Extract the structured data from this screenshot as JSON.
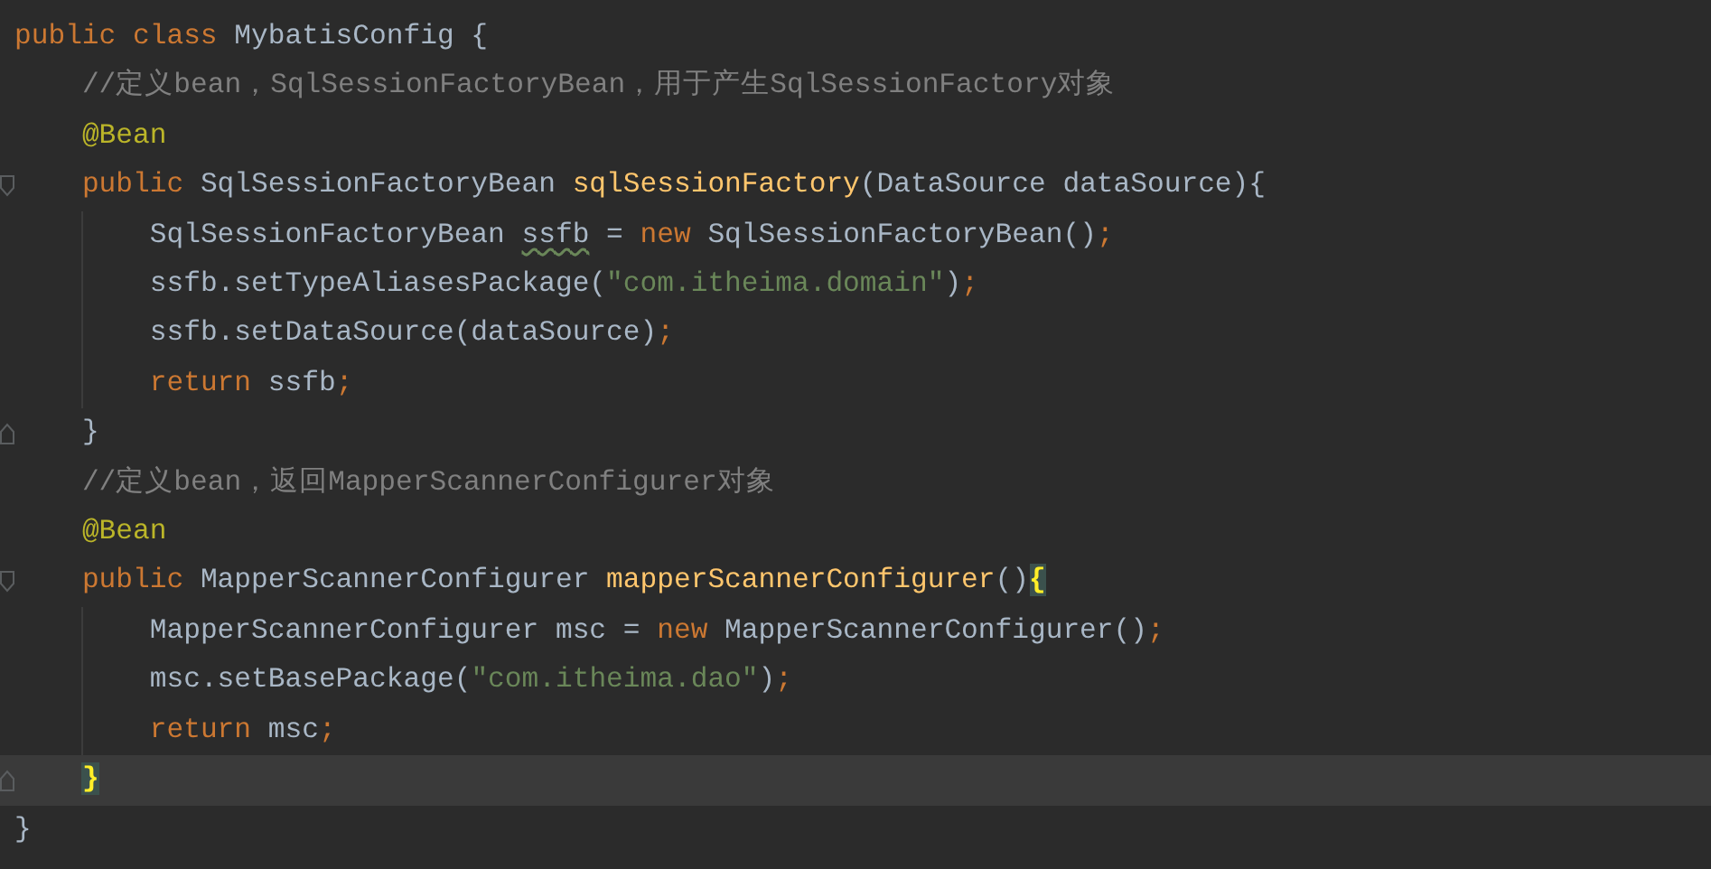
{
  "editor": {
    "lines": [
      {
        "tokens": [
          {
            "text": "public class ",
            "kind": "keyword"
          },
          {
            "text": "MybatisConfig {",
            "kind": "plain"
          }
        ],
        "children": [
          {
            "tokens": [
              {
                "text": "//定义bean，SqlSessionFactoryBean，用于产生SqlSessionFactory对象",
                "kind": "comment"
              }
            ]
          },
          {
            "tokens": [
              {
                "text": "@Bean",
                "kind": "annotation"
              }
            ]
          },
          {
            "kind": "block-start",
            "tokens": [
              {
                "text": "public ",
                "kind": "keyword"
              },
              {
                "text": "SqlSessionFactoryBean ",
                "kind": "plain"
              },
              {
                "text": "sqlSessionFactory",
                "kind": "method"
              },
              {
                "text": "(DataSource dataSource){",
                "kind": "plain"
              }
            ],
            "children": [
              {
                "tokens": [
                  {
                    "text": "SqlSessionFactoryBean ",
                    "kind": "plain"
                  },
                  {
                    "text": "ssfb",
                    "kind": "warning"
                  },
                  {
                    "text": " = ",
                    "kind": "plain"
                  },
                  {
                    "text": "new",
                    "kind": "keyword"
                  },
                  {
                    "text": " SqlSessionFactoryBean()",
                    "kind": "plain"
                  },
                  {
                    "text": ";",
                    "kind": "keyword"
                  }
                ]
              },
              {
                "tokens": [
                  {
                    "text": "ssfb.setTypeAliasesPackage(",
                    "kind": "plain"
                  },
                  {
                    "text": "\"com.itheima.domain\"",
                    "kind": "string"
                  },
                  {
                    "text": ")",
                    "kind": "plain"
                  },
                  {
                    "text": ";",
                    "kind": "keyword"
                  }
                ]
              },
              {
                "tokens": [
                  {
                    "text": "ssfb.setDataSource(dataSource)",
                    "kind": "plain"
                  },
                  {
                    "text": ";",
                    "kind": "keyword"
                  }
                ]
              },
              {
                "tokens": [
                  {
                    "text": "return",
                    "kind": "keyword"
                  },
                  {
                    "text": " ssfb",
                    "kind": "plain"
                  },
                  {
                    "text": ";",
                    "kind": "keyword"
                  }
                ]
              }
            ]
          },
          {
            "kind": "block-end",
            "tokens": [
              {
                "text": "}",
                "kind": "plain"
              }
            ]
          },
          {
            "tokens": [
              {
                "text": "//定义bean，返回MapperScannerConfigurer对象",
                "kind": "comment"
              }
            ]
          },
          {
            "tokens": [
              {
                "text": "@Bean",
                "kind": "annotation"
              }
            ]
          },
          {
            "kind": "block-start",
            "tokens": [
              {
                "text": "public ",
                "kind": "keyword"
              },
              {
                "text": "MapperScannerConfigurer ",
                "kind": "plain"
              },
              {
                "text": "mapperScannerConfigurer",
                "kind": "method"
              },
              {
                "text": "()",
                "kind": "plain"
              },
              {
                "text": "{",
                "kind": "brace-match"
              }
            ],
            "children": [
              {
                "tokens": [
                  {
                    "text": "MapperScannerConfigurer msc = ",
                    "kind": "plain"
                  },
                  {
                    "text": "new",
                    "kind": "keyword"
                  },
                  {
                    "text": " MapperScannerConfigurer()",
                    "kind": "plain"
                  },
                  {
                    "text": ";",
                    "kind": "keyword"
                  }
                ]
              },
              {
                "tokens": [
                  {
                    "text": "msc.setBasePackage(",
                    "kind": "plain"
                  },
                  {
                    "text": "\"com.itheima.dao\"",
                    "kind": "string"
                  },
                  {
                    "text": ")",
                    "kind": "plain"
                  },
                  {
                    "text": ";",
                    "kind": "keyword"
                  }
                ]
              },
              {
                "tokens": [
                  {
                    "text": "return",
                    "kind": "keyword"
                  },
                  {
                    "text": " msc",
                    "kind": "plain"
                  },
                  {
                    "text": ";",
                    "kind": "keyword"
                  }
                ]
              }
            ]
          },
          {
            "kind": "block-end",
            "current": true,
            "tokens": [
              {
                "text": "}",
                "kind": "brace-match"
              }
            ]
          }
        ]
      },
      {
        "tokens": [
          {
            "text": "}",
            "kind": "plain"
          }
        ]
      }
    ]
  }
}
